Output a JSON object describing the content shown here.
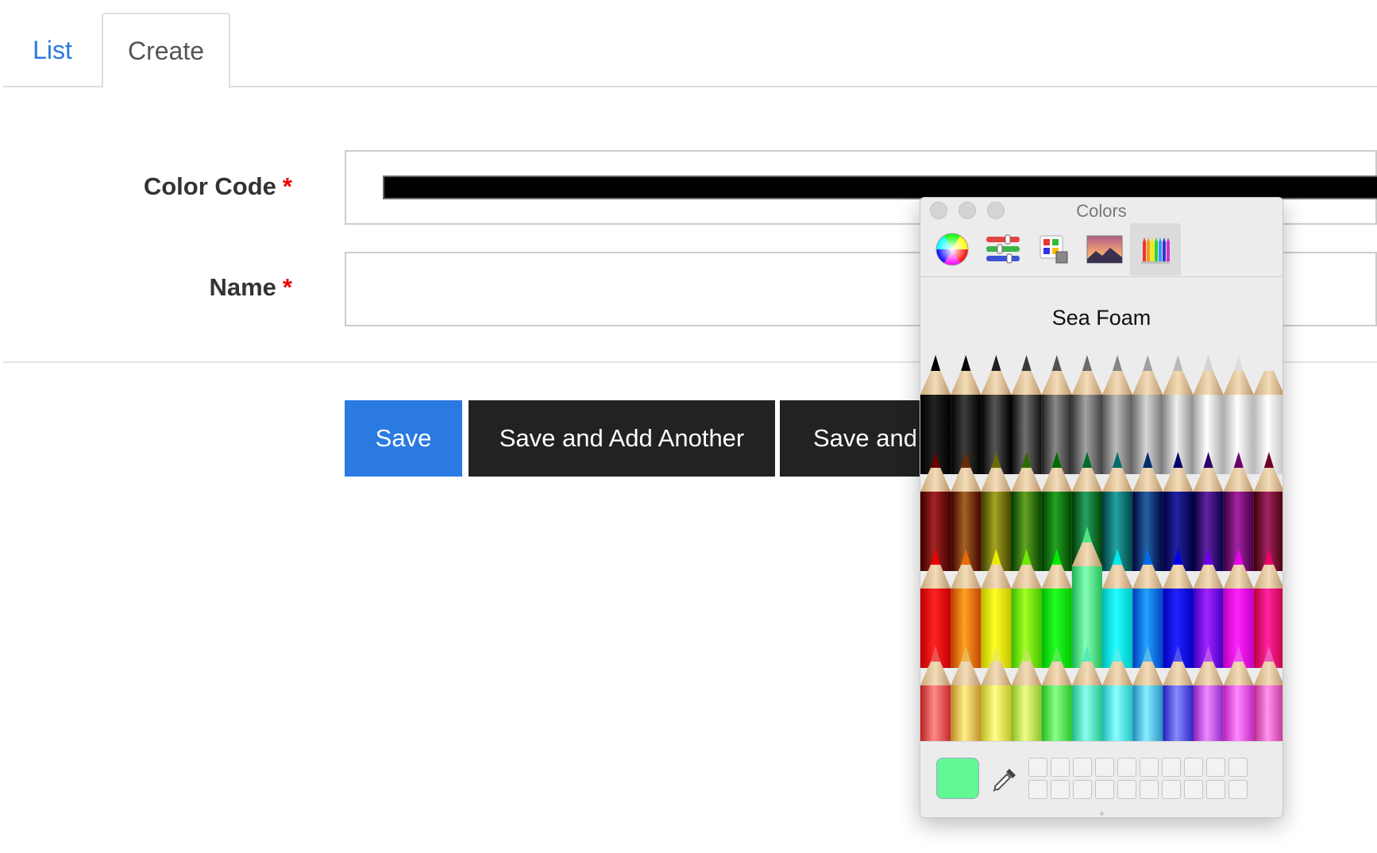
{
  "tabs": [
    {
      "label": "List",
      "active": false
    },
    {
      "label": "Create",
      "active": true
    }
  ],
  "form": {
    "color_code": {
      "label": "Color Code",
      "required_marker": "*",
      "value_color": "#000000"
    },
    "name": {
      "label": "Name",
      "required_marker": "*",
      "value": ""
    }
  },
  "buttons": {
    "save": "Save",
    "save_add_another": "Save and Add Another",
    "save_continue_visible": "Save and"
  },
  "color_panel": {
    "title": "Colors",
    "toolbar": [
      "color-wheel-icon",
      "sliders-icon",
      "palettes-icon",
      "image-palette-icon",
      "pencils-icon"
    ],
    "active_tool": "pencils-icon",
    "selected_color_name": "Sea Foam",
    "selected_color": "#62f895",
    "pencil_rows": [
      [
        "#000000",
        "#1a1a1a",
        "#333333",
        "#4d4d4d",
        "#666666",
        "#7f7f7f",
        "#999999",
        "#b3b3b3",
        "#cccccc",
        "#e6e6e6",
        "#f2f2f2",
        "#ffffff"
      ],
      [
        "#800000",
        "#804000",
        "#808000",
        "#408000",
        "#008000",
        "#008040",
        "#008080",
        "#004080",
        "#000080",
        "#400080",
        "#800080",
        "#800040"
      ],
      [
        "#ff0000",
        "#ff8000",
        "#ffff00",
        "#80ff00",
        "#00ff00",
        "#62f895",
        "#00ffff",
        "#0080ff",
        "#0000ff",
        "#8000ff",
        "#ff00ff",
        "#ff0080"
      ],
      [
        "#ff6666",
        "#ffcc66",
        "#ffff66",
        "#ccff66",
        "#66ff66",
        "#66ffcc",
        "#66ffff",
        "#66ccff",
        "#6666ff",
        "#cc66ff",
        "#ff66ff",
        "#ff6fcf"
      ]
    ],
    "selected_pencil": {
      "row": 2,
      "col": 5
    }
  },
  "colors": {
    "accent": "#2a7ae2",
    "dark_button": "#222222",
    "required": "#ee0000"
  }
}
